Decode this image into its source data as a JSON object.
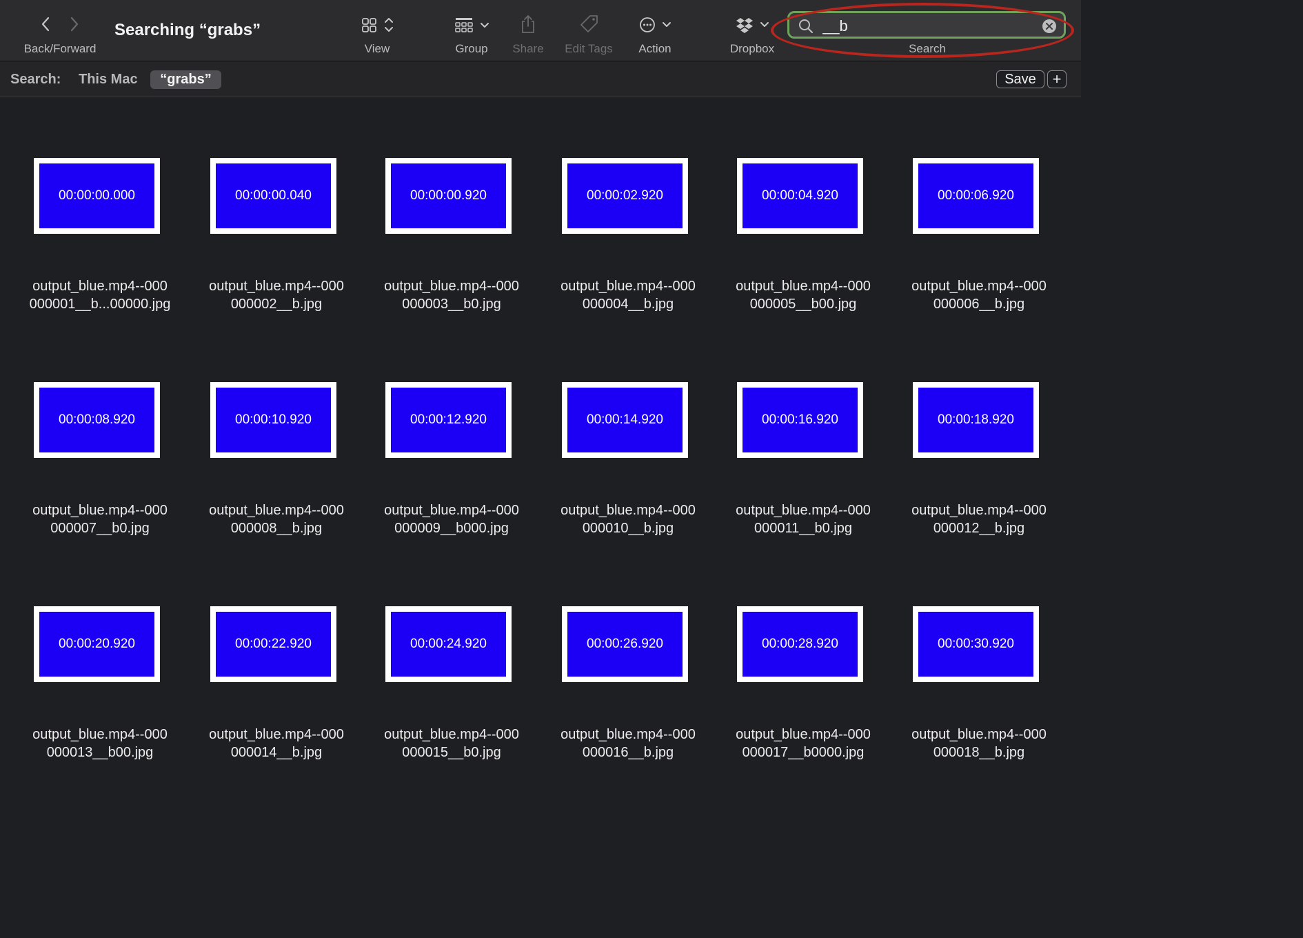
{
  "toolbar": {
    "nav_label": "Back/Forward",
    "title": "Searching “grabs”",
    "view_label": "View",
    "group_label": "Group",
    "share_label": "Share",
    "edit_tags_label": "Edit Tags",
    "action_label": "Action",
    "dropbox_label": "Dropbox",
    "search_label": "Search",
    "search_value": "__b"
  },
  "scopebar": {
    "search_label": "Search:",
    "scope_this_mac": "This Mac",
    "scope_grabs": "“grabs”",
    "save_label": "Save",
    "add_label": "+"
  },
  "colors": {
    "thumb_blue": "#1b00f5",
    "search_focus_ring": "#6fa25a",
    "annotation_red": "#b8261e"
  },
  "files": [
    {
      "timestamp": "00:00:00.000",
      "name_line1": "output_blue.mp4--000",
      "name_line2": "000001__b...00000.jpg"
    },
    {
      "timestamp": "00:00:00.040",
      "name_line1": "output_blue.mp4--000",
      "name_line2": "000002__b.jpg"
    },
    {
      "timestamp": "00:00:00.920",
      "name_line1": "output_blue.mp4--000",
      "name_line2": "000003__b0.jpg"
    },
    {
      "timestamp": "00:00:02.920",
      "name_line1": "output_blue.mp4--000",
      "name_line2": "000004__b.jpg"
    },
    {
      "timestamp": "00:00:04.920",
      "name_line1": "output_blue.mp4--000",
      "name_line2": "000005__b00.jpg"
    },
    {
      "timestamp": "00:00:06.920",
      "name_line1": "output_blue.mp4--000",
      "name_line2": "000006__b.jpg"
    },
    {
      "timestamp": "00:00:08.920",
      "name_line1": "output_blue.mp4--000",
      "name_line2": "000007__b0.jpg"
    },
    {
      "timestamp": "00:00:10.920",
      "name_line1": "output_blue.mp4--000",
      "name_line2": "000008__b.jpg"
    },
    {
      "timestamp": "00:00:12.920",
      "name_line1": "output_blue.mp4--000",
      "name_line2": "000009__b000.jpg"
    },
    {
      "timestamp": "00:00:14.920",
      "name_line1": "output_blue.mp4--000",
      "name_line2": "000010__b.jpg"
    },
    {
      "timestamp": "00:00:16.920",
      "name_line1": "output_blue.mp4--000",
      "name_line2": "000011__b0.jpg"
    },
    {
      "timestamp": "00:00:18.920",
      "name_line1": "output_blue.mp4--000",
      "name_line2": "000012__b.jpg"
    },
    {
      "timestamp": "00:00:20.920",
      "name_line1": "output_blue.mp4--000",
      "name_line2": "000013__b00.jpg"
    },
    {
      "timestamp": "00:00:22.920",
      "name_line1": "output_blue.mp4--000",
      "name_line2": "000014__b.jpg"
    },
    {
      "timestamp": "00:00:24.920",
      "name_line1": "output_blue.mp4--000",
      "name_line2": "000015__b0.jpg"
    },
    {
      "timestamp": "00:00:26.920",
      "name_line1": "output_blue.mp4--000",
      "name_line2": "000016__b.jpg"
    },
    {
      "timestamp": "00:00:28.920",
      "name_line1": "output_blue.mp4--000",
      "name_line2": "000017__b0000.jpg"
    },
    {
      "timestamp": "00:00:30.920",
      "name_line1": "output_blue.mp4--000",
      "name_line2": "000018__b.jpg"
    }
  ]
}
